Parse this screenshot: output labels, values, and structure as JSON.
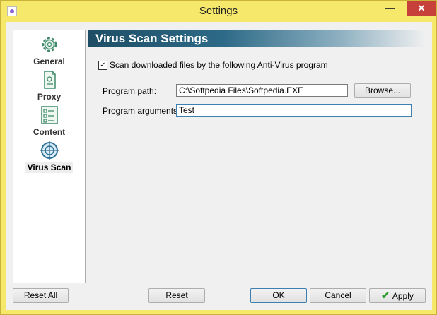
{
  "window": {
    "title": "Settings"
  },
  "sidebar": {
    "items": [
      {
        "label": "General",
        "icon": "gear-icon"
      },
      {
        "label": "Proxy",
        "icon": "document-icon"
      },
      {
        "label": "Content",
        "icon": "checklist-icon"
      },
      {
        "label": "Virus Scan",
        "icon": "crosshair-icon",
        "selected": true
      }
    ]
  },
  "panel": {
    "title": "Virus Scan Settings",
    "scan_checkbox": {
      "label": "Scan downloaded files by the following Anti-Virus program",
      "checked": true
    },
    "program_path": {
      "label": "Program path:",
      "value": "C:\\Softpedia Files\\Softpedia.EXE"
    },
    "browse_button": "Browse...",
    "program_arguments": {
      "label": "Program arguments:",
      "value": "Test"
    }
  },
  "footer": {
    "reset_all": "Reset All",
    "reset": "Reset",
    "ok": "OK",
    "cancel": "Cancel",
    "apply": "Apply"
  }
}
